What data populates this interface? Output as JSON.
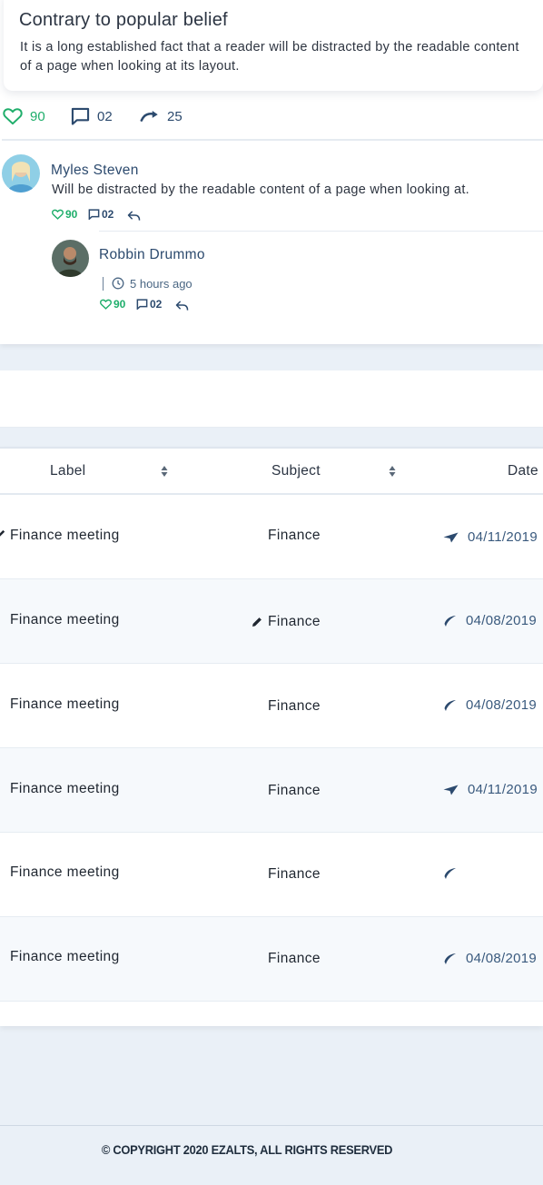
{
  "post": {
    "title": "Contrary to popular belief",
    "body": "It is a long established fact that a reader will be distracted by the readable content of a page when looking at its layout."
  },
  "stats": {
    "likes": "90",
    "comments": "02",
    "shares": "25"
  },
  "comments": [
    {
      "name": "Myles Steven",
      "text": "Will be distracted by the readable content of a page when looking at.",
      "likes": "90",
      "replies": "02"
    },
    {
      "name": "Robbin Drummo",
      "time": "5 hours ago",
      "likes": "90",
      "replies": "02"
    }
  ],
  "table": {
    "headers": {
      "label": "Label",
      "subject": "Subject",
      "date": "Date"
    },
    "rows": [
      {
        "label": "Finance meeting",
        "subject": "Finance",
        "date": "04/11/2019",
        "icon": "send-icon"
      },
      {
        "label": "Finance meeting",
        "subject": "Finance",
        "date": "04/08/2019",
        "icon": "feather-icon"
      },
      {
        "label": "Finance meeting",
        "subject": "Finance",
        "date": "04/08/2019",
        "icon": "feather-icon"
      },
      {
        "label": "Finance meeting",
        "subject": "Finance",
        "date": "04/11/2019",
        "icon": "send-icon"
      },
      {
        "label": "Finance meeting",
        "subject": "Finance",
        "date": "",
        "icon": "feather-icon"
      },
      {
        "label": "Finance meeting",
        "subject": "Finance",
        "date": "04/08/2019",
        "icon": "feather-icon"
      }
    ]
  },
  "footer": {
    "copyright": "© COPYRIGHT 2020 EZALTS, ALL RIGHTS RESERVED"
  },
  "colors": {
    "accent_green": "#1fae6b",
    "navy": "#2c4a6e",
    "page_bg": "#eaf0f7"
  }
}
